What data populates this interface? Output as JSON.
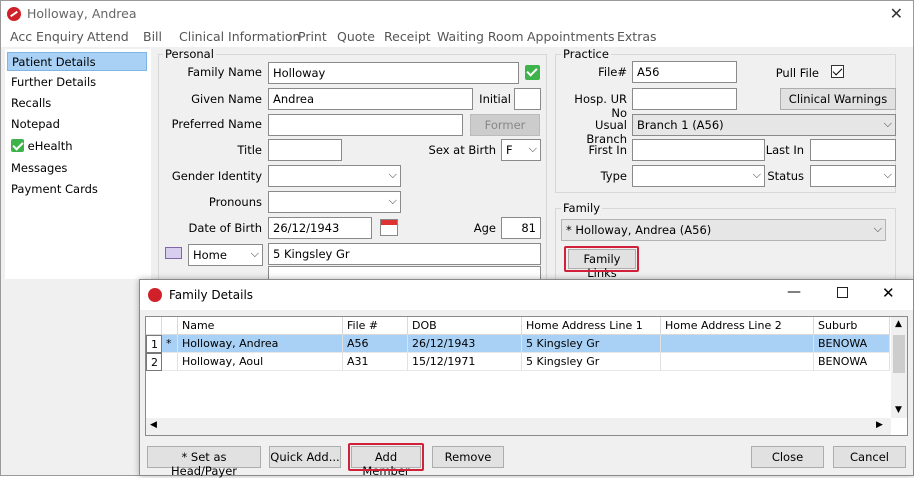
{
  "window": {
    "title": "Holloway, Andrea"
  },
  "menu": [
    "Acc Enquiry",
    "Attend",
    "Bill",
    "Clinical Information",
    "Print",
    "Quote",
    "Receipt",
    "Waiting Room",
    "Appointments",
    "Extras"
  ],
  "sidebar": {
    "items": [
      {
        "label": "Patient Details"
      },
      {
        "label": "Further Details"
      },
      {
        "label": "Recalls"
      },
      {
        "label": "Notepad"
      },
      {
        "label": "eHealth"
      },
      {
        "label": "Messages"
      },
      {
        "label": "Payment Cards"
      }
    ]
  },
  "personal": {
    "legend": "Personal",
    "family_name_label": "Family Name",
    "family_name": "Holloway",
    "given_name_label": "Given Name",
    "given_name": "Andrea",
    "initial_label": "Initial",
    "initial": "",
    "preferred_name_label": "Preferred Name",
    "preferred_name": "",
    "former_button": "Former",
    "title_label": "Title",
    "title": "",
    "sex_label": "Sex at Birth",
    "sex": "F",
    "gender_label": "Gender Identity",
    "gender": "",
    "pronouns_label": "Pronouns",
    "pronouns": "",
    "dob_label": "Date of Birth",
    "dob": "26/12/1943",
    "age_label": "Age",
    "age": "81",
    "address_type": "Home",
    "address_line1": "5 Kingsley  Gr"
  },
  "practice": {
    "legend": "Practice",
    "file_label": "File#",
    "file": "A56",
    "pull_file_label": "Pull File",
    "hosp_label": "Hosp. UR No",
    "hosp": "",
    "clinical_warnings_button": "Clinical Warnings",
    "usual_branch_label": "Usual Branch",
    "usual_branch": "Branch 1  (A56)",
    "first_in_label": "First In",
    "first_in": "",
    "last_in_label": "Last In",
    "last_in": "",
    "type_label": "Type",
    "type": "",
    "status_label": "Status",
    "status": ""
  },
  "family": {
    "legend": "Family",
    "selected": "* Holloway, Andrea (A56)",
    "links_button": "Family Links"
  },
  "dialog": {
    "title": "Family Details",
    "columns": [
      "Name",
      "File #",
      "DOB",
      "Home Address Line 1",
      "Home Address Line 2",
      "Suburb"
    ],
    "rows": [
      {
        "num": "1",
        "mark": "*",
        "name": "Holloway, Andrea",
        "file": "A56",
        "dob": "26/12/1943",
        "addr1": "5 Kingsley  Gr",
        "addr2": "",
        "suburb": "BENOWA"
      },
      {
        "num": "2",
        "mark": "",
        "name": "Holloway, Aoul",
        "file": "A31",
        "dob": "15/12/1971",
        "addr1": "5 Kingsley  Gr",
        "addr2": "",
        "suburb": "BENOWA"
      }
    ],
    "buttons": {
      "set_head": "* Set as Head/Payer",
      "quick_add": "Quick Add...",
      "add_member": "Add Member",
      "remove": "Remove",
      "close": "Close",
      "cancel": "Cancel"
    }
  },
  "colors": {
    "selection": "#a8d1f5",
    "highlight_box": "#d0203a",
    "check_green": "#3db34a"
  }
}
